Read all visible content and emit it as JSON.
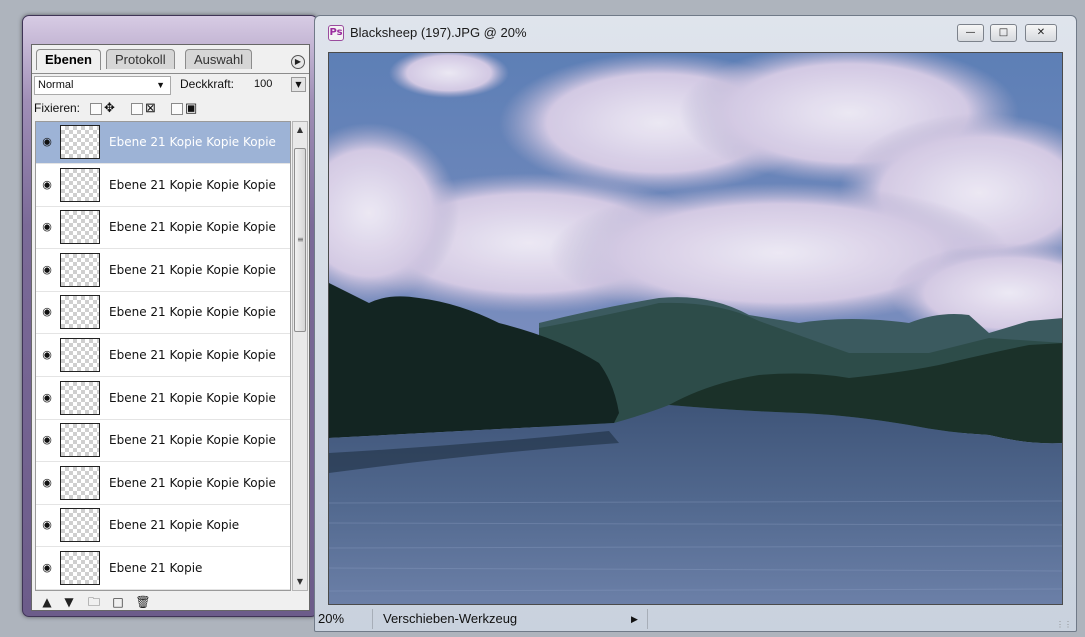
{
  "layers_panel": {
    "tabs": [
      "Ebenen",
      "Protokoll",
      "Auswahl"
    ],
    "blend_mode": "Normal",
    "opacity_label": "Deckkraft:",
    "opacity_value": "100",
    "lock_label": "Fixieren:",
    "layers": [
      {
        "name": "Ebene 21 Kopie Kopie Kopie",
        "visible": true,
        "selected": true
      },
      {
        "name": "Ebene 21 Kopie Kopie Kopie",
        "visible": true,
        "selected": false
      },
      {
        "name": "Ebene 21 Kopie Kopie Kopie",
        "visible": true,
        "selected": false
      },
      {
        "name": "Ebene 21 Kopie Kopie Kopie",
        "visible": true,
        "selected": false
      },
      {
        "name": "Ebene 21 Kopie Kopie Kopie",
        "visible": true,
        "selected": false
      },
      {
        "name": "Ebene 21 Kopie Kopie Kopie",
        "visible": true,
        "selected": false
      },
      {
        "name": "Ebene 21 Kopie Kopie Kopie",
        "visible": true,
        "selected": false
      },
      {
        "name": "Ebene 21 Kopie Kopie Kopie",
        "visible": true,
        "selected": false
      },
      {
        "name": "Ebene 21 Kopie Kopie Kopie",
        "visible": true,
        "selected": false
      },
      {
        "name": "Ebene 21 Kopie Kopie",
        "visible": true,
        "selected": false
      },
      {
        "name": "Ebene 21 Kopie",
        "visible": true,
        "selected": false
      }
    ],
    "footer_icons": [
      "move-up-icon",
      "move-down-icon",
      "new-folder-icon",
      "new-layer-icon",
      "trash-icon"
    ]
  },
  "document": {
    "title": "Blacksheep (197).JPG @ 20%",
    "zoom": "20%",
    "tool_name": "Verschieben-Werkzeug"
  },
  "colors": {
    "panel_frame": "#7b6a98",
    "selected_row": "#9db3d6",
    "sky": "#5b79a5"
  }
}
